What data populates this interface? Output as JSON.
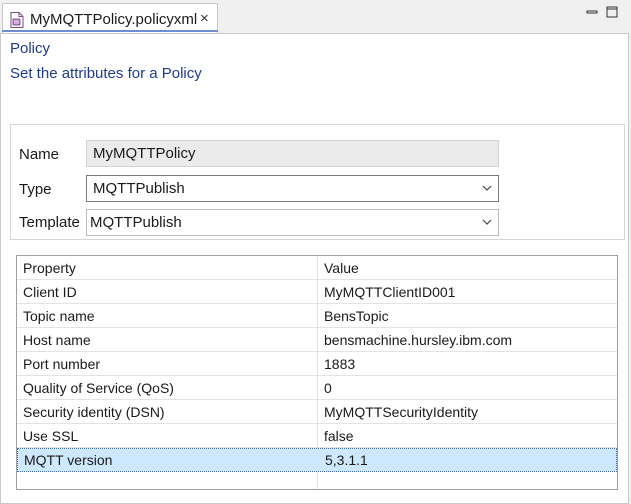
{
  "tab": {
    "title": "MyMQTTPolicy.policyxml",
    "close_glyph": "×",
    "icon": "policy-file-icon"
  },
  "window": {
    "minimize_icon": "minimize-icon",
    "maximize_icon": "maximize-icon"
  },
  "header": {
    "title": "Policy",
    "subtitle": "Set the attributes for a Policy"
  },
  "form": {
    "name_label": "Name",
    "name_value": "MyMQTTPolicy",
    "type_label": "Type",
    "type_value": "MQTTPublish",
    "template_label": "Template",
    "template_value": "MQTTPublish"
  },
  "table": {
    "headers": [
      "Property",
      "Value"
    ],
    "rows": [
      [
        "Client ID",
        "MyMQTTClientID001"
      ],
      [
        "Topic name",
        "BensTopic"
      ],
      [
        "Host name",
        "bensmachine.hursley.ibm.com"
      ],
      [
        "Port number",
        "1883"
      ],
      [
        "Quality of Service (QoS)",
        "0"
      ],
      [
        "Security identity (DSN)",
        "MyMQTTSecurityIdentity"
      ],
      [
        "Use SSL",
        "false"
      ],
      [
        "MQTT version",
        "5,3.1.1"
      ]
    ],
    "selected_row": "MQTT version"
  },
  "colors": {
    "accent": "#6b8fd1",
    "heading": "#1f3a93",
    "selection": "#cde8ff"
  }
}
